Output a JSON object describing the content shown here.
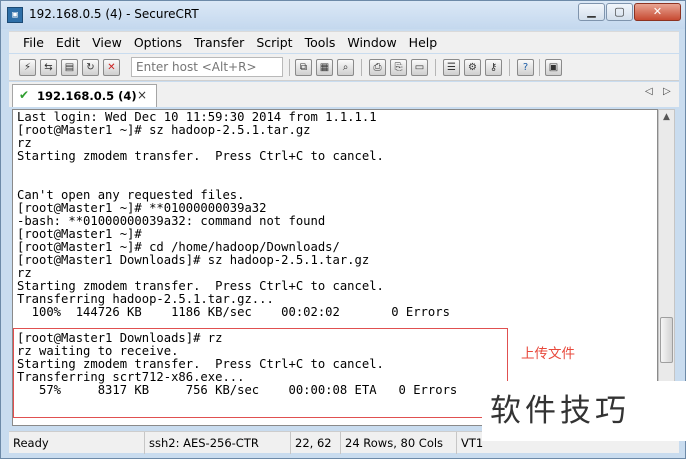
{
  "window": {
    "title": "192.168.0.5 (4) - SecureCRT"
  },
  "menu": [
    "File",
    "Edit",
    "View",
    "Options",
    "Transfer",
    "Script",
    "Tools",
    "Window",
    "Help"
  ],
  "toolbar": {
    "host_placeholder": "Enter host <Alt+R>"
  },
  "tab": {
    "label": "192.168.0.5 (4)",
    "close": "×"
  },
  "terminal": {
    "lines": [
      "Last login: Wed Dec 10 11:59:30 2014 from 1.1.1.1",
      "[root@Master1 ~]# sz hadoop-2.5.1.tar.gz",
      "rz",
      "Starting zmodem transfer.  Press Ctrl+C to cancel.",
      "",
      "",
      "Can't open any requested files.",
      "[root@Master1 ~]# **01000000039a32",
      "-bash: **01000000039a32: command not found",
      "[root@Master1 ~]#",
      "[root@Master1 ~]# cd /home/hadoop/Downloads/",
      "[root@Master1 Downloads]# sz hadoop-2.5.1.tar.gz",
      "rz",
      "Starting zmodem transfer.  Press Ctrl+C to cancel.",
      "Transferring hadoop-2.5.1.tar.gz...",
      "  100%  144726 KB    1186 KB/sec    00:02:02       0 Errors",
      "",
      "[root@Master1 Downloads]# rz",
      "rz waiting to receive.",
      "Starting zmodem transfer.  Press Ctrl+C to cancel.",
      "Transferring scrt712-x86.exe...",
      "   57%     8317 KB     756 KB/sec    00:00:08 ETA   0 Errors"
    ]
  },
  "annotation": "上传文件",
  "status": {
    "ready": "Ready",
    "ssh": "ssh2: AES-256-CTR",
    "position": "22,  62",
    "size": "24 Rows, 80 Cols",
    "term": "VT1"
  },
  "watermark": "软件技巧"
}
